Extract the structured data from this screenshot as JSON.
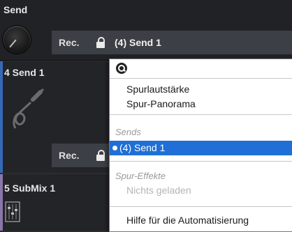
{
  "send_panel": {
    "title": "Send",
    "rec_label": "Rec.",
    "send_value": "(4) Send 1"
  },
  "track": {
    "title": "4 Send 1",
    "rec_label": "Rec.",
    "color": "#3569b8"
  },
  "submix": {
    "title": "5 SubMix 1",
    "color": "#8a76a8"
  },
  "menu": {
    "search_placeholder": "",
    "items": [
      "Spurlautstärke",
      "Spur-Panorama"
    ],
    "sends_header": "Sends",
    "sends_selected": "(4) Send 1",
    "effects_header": "Spur-Effekte",
    "effects_empty": "Nichts geladen",
    "help": "Hilfe für die Automatisierung",
    "highlight_color": "#1f6fd6"
  }
}
